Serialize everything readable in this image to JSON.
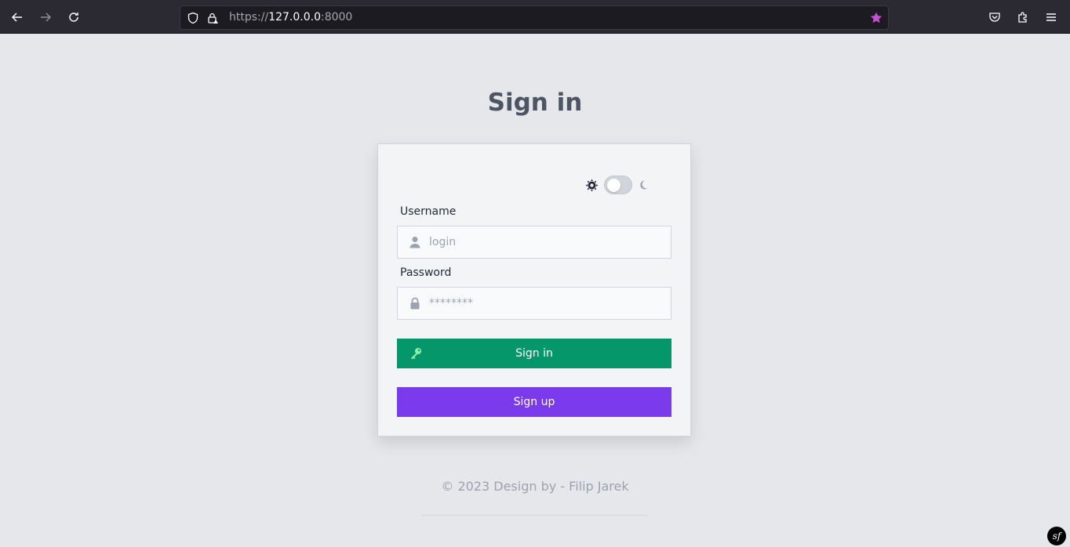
{
  "browser": {
    "url_prefix": "https://",
    "url_host": "127.0.0.0",
    "url_port": ":8000"
  },
  "page": {
    "title": "Sign in"
  },
  "form": {
    "username_label": "Username",
    "username_placeholder": "login",
    "password_label": "Password",
    "password_placeholder": "********",
    "signin_label": "Sign in",
    "signup_label": "Sign up",
    "theme_toggle_on": false
  },
  "footer": {
    "text": "© 2023 Design by - Filip Jarek"
  },
  "colors": {
    "signin_button": "#059669",
    "signup_button": "#7c3aed",
    "background": "#e5e7eb"
  }
}
